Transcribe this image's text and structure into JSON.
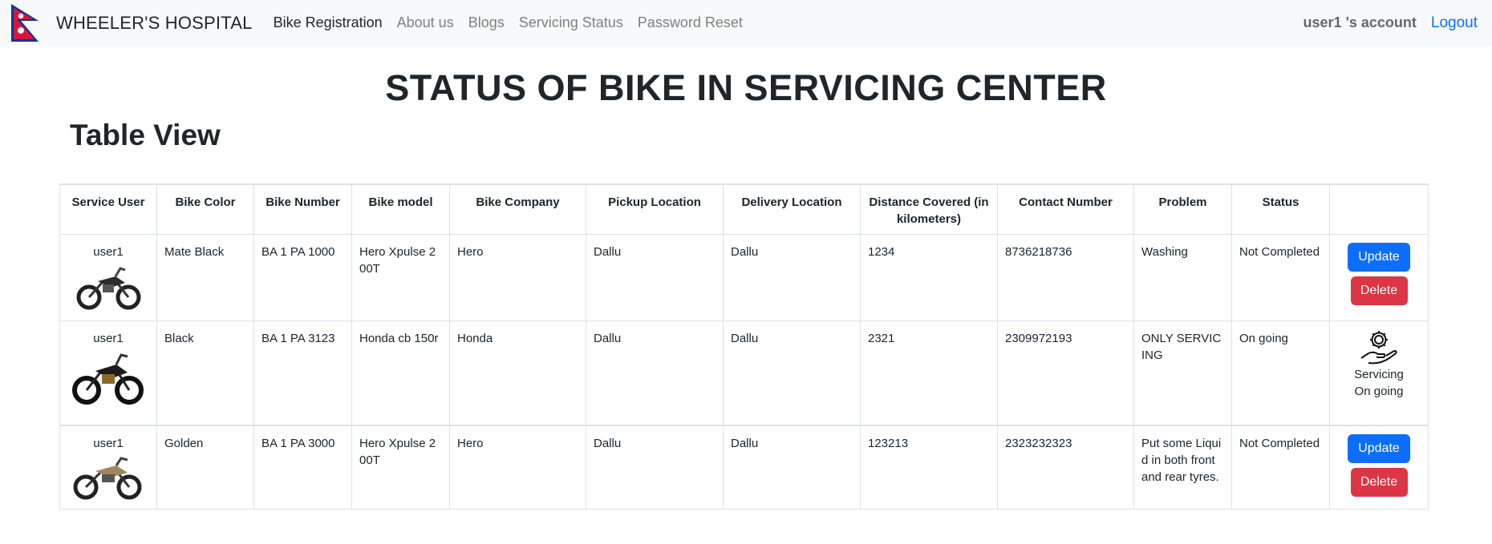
{
  "nav": {
    "brand": "WHEELER'S HOSPITAL",
    "links": [
      "Bike Registration",
      "About us",
      "Blogs",
      "Servicing Status",
      "Password Reset"
    ],
    "account": "user1 's account",
    "logout": "Logout"
  },
  "page": {
    "title": "STATUS OF BIKE IN SERVICING CENTER",
    "section_title": "Table View"
  },
  "table": {
    "headers": [
      "Service User",
      "Bike Color",
      "Bike Number",
      "Bike model",
      "Bike Company",
      "Pickup Location",
      "Delivery Location",
      "Distance Covered (in kilometers)",
      "Contact Number",
      "Problem",
      "Status",
      ""
    ],
    "rows": [
      {
        "user": "user1",
        "color": "Mate Black",
        "number": "BA 1 PA 1000",
        "model": "Hero Xpulse 200T",
        "company": "Hero",
        "pickup": "Dallu",
        "delivery": "Dallu",
        "distance": "1234",
        "contact": "8736218736",
        "problem": "Washing",
        "status": "Not Completed",
        "update_label": "Update",
        "delete_label": "Delete",
        "bike_icon": "motorcycle-icon"
      },
      {
        "user": "user1",
        "color": "Black",
        "number": "BA 1 PA 3123",
        "model": "Honda cb 150r",
        "company": "Honda",
        "pickup": "Dallu",
        "delivery": "Dallu",
        "distance": "2321",
        "contact": "2309972193",
        "problem": "ONLY SERVICING",
        "status": "On going",
        "servicing_line1": "Servicing",
        "servicing_line2": "On going",
        "bike_icon": "motorcycle-icon"
      },
      {
        "user": "user1",
        "color": "Golden",
        "number": "BA 1 PA 3000",
        "model": "Hero Xpulse 200T",
        "company": "Hero",
        "pickup": "Dallu",
        "delivery": "Dallu",
        "distance": "123213",
        "contact": "2323232323",
        "problem": "Put some Liquid in both front and rear tyres.",
        "status": "Not Completed",
        "update_label": "Update",
        "delete_label": "Delete",
        "bike_icon": "motorcycle-icon"
      }
    ]
  },
  "colors": {
    "primary": "#0d6efd",
    "danger": "#dc3545",
    "navbar_bg": "#f8f9fa",
    "flag_red": "#DC143C",
    "flag_blue": "#003893"
  }
}
